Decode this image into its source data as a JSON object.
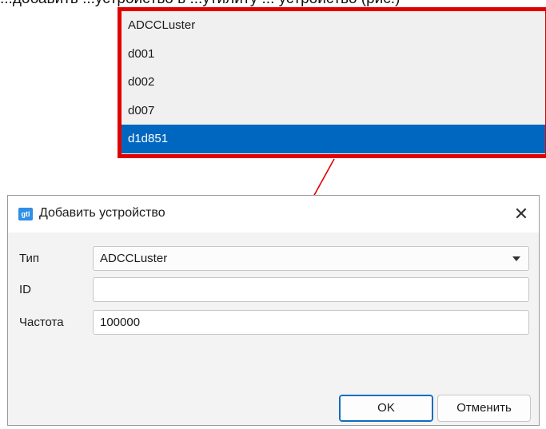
{
  "caption": "...добавить ...устройство в ...утилиту ... устройство (рис.)",
  "dropdown": {
    "options": [
      "ADCCLuster",
      "d001",
      "d002",
      "d007",
      "d1d851"
    ],
    "selected_index": 4
  },
  "dialog": {
    "app_icon_text": "gtl",
    "title": "Добавить устройство",
    "close_glyph": "✕",
    "type_label": "Тип",
    "type_value": "ADCCLuster",
    "id_label": "ID",
    "id_value": "",
    "freq_label": "Частота",
    "freq_value": "100000",
    "ok_label": "OK",
    "cancel_label": "Отменить"
  },
  "colors": {
    "highlight_border": "#e00000",
    "selection": "#0067c0",
    "arrow": "#e00000"
  }
}
